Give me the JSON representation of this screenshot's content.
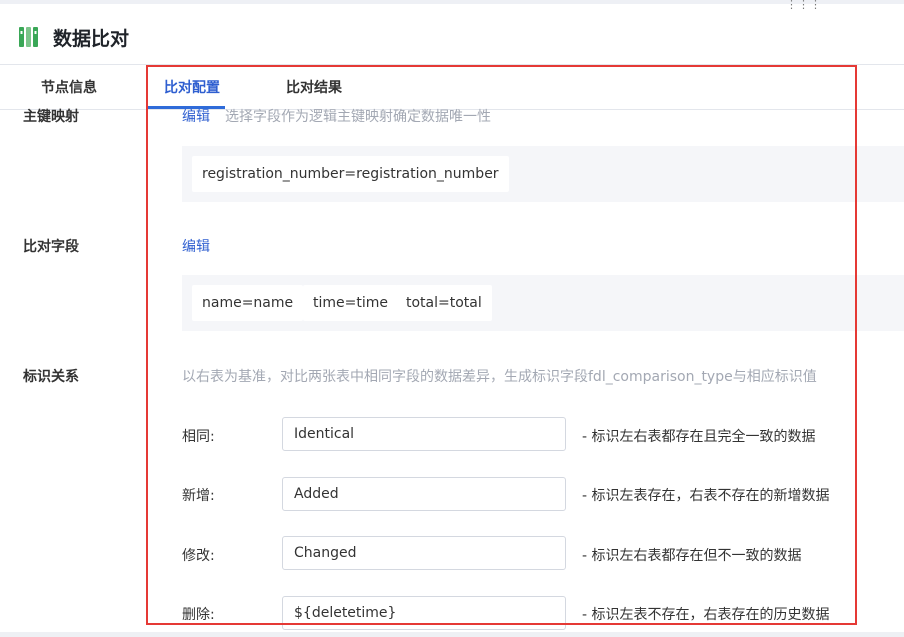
{
  "header": {
    "title": "数据比对",
    "icon": "bookshelf-icon",
    "accent_color": "#3aa757"
  },
  "tabs": [
    {
      "label": "节点信息",
      "active": false
    },
    {
      "label": "比对配置",
      "active": true
    },
    {
      "label": "比对结果",
      "active": false
    }
  ],
  "primary_key": {
    "label": "主键映射",
    "edit": "编辑",
    "hint": "选择字段作为逻辑主键映射确定数据唯一性",
    "mappings": [
      "registration_number=registration_number"
    ]
  },
  "compare_fields": {
    "label": "比对字段",
    "edit": "编辑",
    "mappings": [
      "name=name",
      "time=time",
      "total=total"
    ]
  },
  "identify": {
    "label": "标识关系",
    "hint": "以右表为基准，对比两张表中相同字段的数据差异，生成标识字段fdl_comparison_type与相应标识值",
    "rows": [
      {
        "label": "相同:",
        "value": "Identical",
        "desc": "- 标识左右表都存在且完全一致的数据"
      },
      {
        "label": "新增:",
        "value": "Added",
        "desc": "- 标识左表存在，右表不存在的新增数据"
      },
      {
        "label": "修改:",
        "value": "Changed",
        "desc": "- 标识左右表都存在但不一致的数据"
      },
      {
        "label": "删除:",
        "value": "${deletetime}",
        "desc": "- 标识左表不存在，右表存在的历史数据"
      }
    ]
  },
  "colors": {
    "link": "#2f5fd0",
    "highlight_border": "#e53935"
  }
}
